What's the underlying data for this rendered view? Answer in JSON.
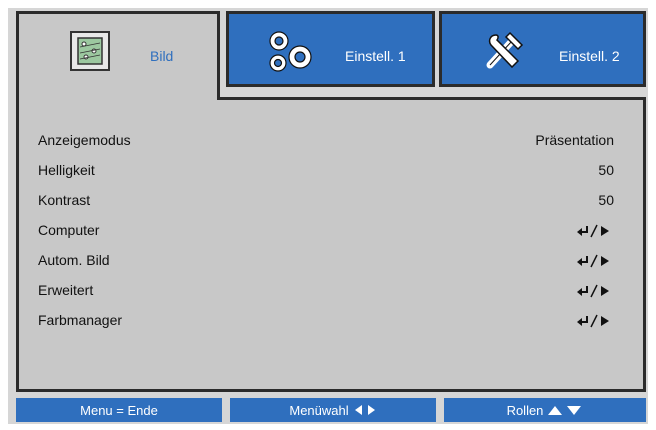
{
  "tabs": [
    {
      "label": "Bild",
      "icon": "picture-icon",
      "active": true
    },
    {
      "label": "Einstell. 1",
      "icon": "gears-icon",
      "active": false
    },
    {
      "label": "Einstell. 2",
      "icon": "tools-icon",
      "active": false
    }
  ],
  "menu": {
    "rows": [
      {
        "label": "Anzeigemodus",
        "value": "Präsentation"
      },
      {
        "label": "Helligkeit",
        "value": "50"
      },
      {
        "label": "Kontrast",
        "value": "50"
      },
      {
        "label": "Computer",
        "value": ""
      },
      {
        "label": "Autom. Bild",
        "value": ""
      },
      {
        "label": "Erweitert",
        "value": ""
      },
      {
        "label": "Farbmanager",
        "value": ""
      }
    ]
  },
  "footer": {
    "exit": "Menu = Ende",
    "select": "Menüwahl",
    "scroll": "Rollen"
  },
  "colors": {
    "accent_blue": "#2f6fbe",
    "panel_grey": "#c8c8c8",
    "frame_grey": "#d6d6d6",
    "border_dark": "#2b2b2b"
  }
}
